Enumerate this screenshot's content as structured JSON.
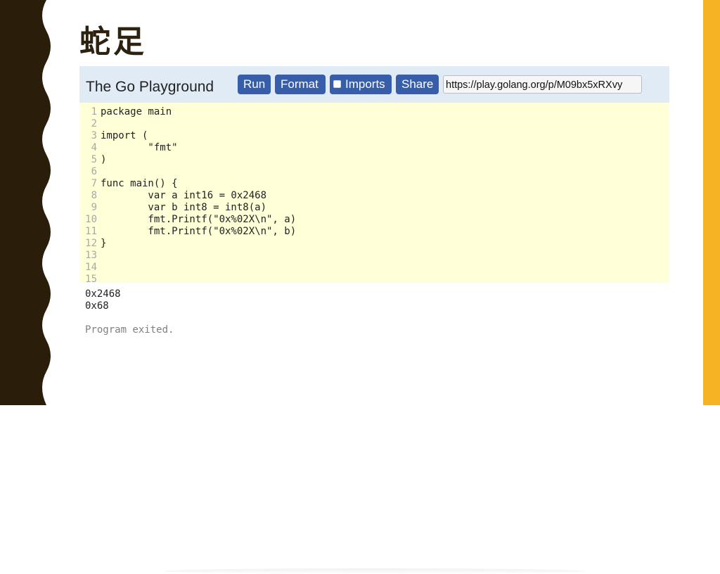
{
  "slide": {
    "title": "蛇足",
    "colors": {
      "left_panel": "#2a1d0a",
      "right_bar": "#f6b323"
    }
  },
  "playground": {
    "title": "The Go Playground",
    "buttons": {
      "run": "Run",
      "format": "Format",
      "imports": "Imports",
      "share": "Share"
    },
    "url": "https://play.golang.org/p/M09bx5xRXvy",
    "colors": {
      "header_bg": "#e0ebf5",
      "button_bg": "#375eab",
      "editor_bg": "#ffffd8"
    },
    "code_lines": [
      {
        "num": "1",
        "text": "package main"
      },
      {
        "num": "2",
        "text": ""
      },
      {
        "num": "3",
        "text": "import ("
      },
      {
        "num": "4",
        "text": "        \"fmt\""
      },
      {
        "num": "5",
        "text": ")"
      },
      {
        "num": "6",
        "text": ""
      },
      {
        "num": "7",
        "text": "func main() {"
      },
      {
        "num": "8",
        "text": "        var a int16 = 0x2468"
      },
      {
        "num": "9",
        "text": "        var b int8 = int8(a)"
      },
      {
        "num": "10",
        "text": "        fmt.Printf(\"0x%02X\\n\", a)"
      },
      {
        "num": "11",
        "text": "        fmt.Printf(\"0x%02X\\n\", b)"
      },
      {
        "num": "12",
        "text": "}"
      },
      {
        "num": "13",
        "text": ""
      },
      {
        "num": "14",
        "text": ""
      },
      {
        "num": "15",
        "text": ""
      }
    ],
    "output": {
      "lines": [
        "0x2468",
        "0x68"
      ],
      "exit_message": "Program exited."
    }
  }
}
